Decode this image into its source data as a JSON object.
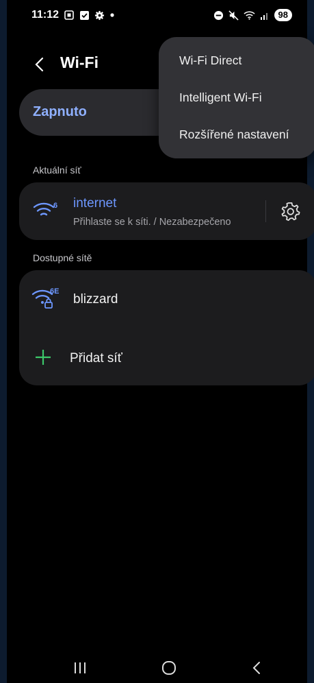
{
  "status_bar": {
    "time": "11:12",
    "battery": "98",
    "icons_left": [
      "screenshot-icon",
      "message-icon",
      "settings-gear-icon",
      "dot-icon"
    ],
    "icons_right": [
      "do-not-disturb-icon",
      "mute-icon",
      "wifi-icon",
      "signal-icon"
    ]
  },
  "header": {
    "title": "Wi-Fi"
  },
  "toggle": {
    "label": "Zapnuto",
    "accent": "#8fb0ff"
  },
  "current_section": {
    "label": "Aktuální síť",
    "network": {
      "name": "internet",
      "status": "Přihlaste se k síti. / Nezabezpečeno",
      "wifi_badge": "6",
      "icon": "wifi-icon",
      "accent": "#6d97ff"
    }
  },
  "available_section": {
    "label": "Dostupné sítě",
    "networks": [
      {
        "name": "blizzard",
        "wifi_badge": "6E",
        "icon": "wifi-lock-icon",
        "accent": "#6d97ff"
      }
    ],
    "add_label": "Přidat síť",
    "add_accent": "#3cc86a"
  },
  "menu": {
    "items": [
      {
        "label": "Wi-Fi Direct"
      },
      {
        "label": "Intelligent Wi-Fi"
      },
      {
        "label": "Rozšířené nastavení"
      }
    ]
  },
  "nav_bar": {
    "icons": [
      "recents-icon",
      "home-icon",
      "back-icon"
    ]
  }
}
